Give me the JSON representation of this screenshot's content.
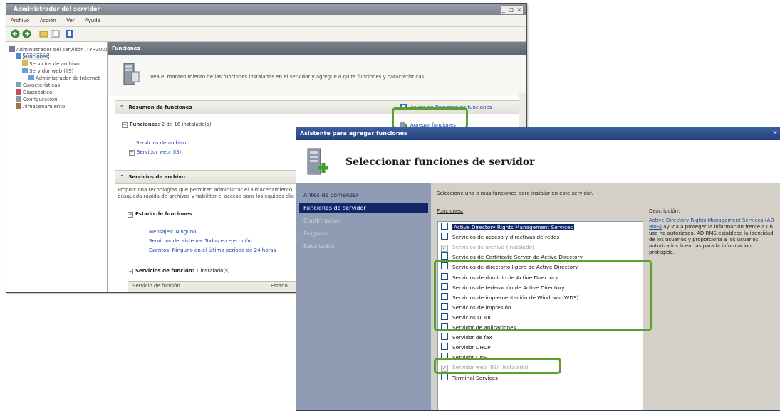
{
  "server_manager": {
    "title": "Administrador del servidor",
    "window_controls": "_ □ ×",
    "menu": [
      "Archivo",
      "Acción",
      "Ver",
      "Ayuda"
    ],
    "tree": [
      {
        "label": "Administrador del servidor (TYR300)",
        "indent": 0,
        "icon": "server-icon"
      },
      {
        "label": "Funciones",
        "indent": 1,
        "icon": "roles-icon",
        "selected": true
      },
      {
        "label": "Servicios de archivo",
        "indent": 2,
        "icon": "file-services-icon"
      },
      {
        "label": "Servidor web (IIS)",
        "indent": 2,
        "icon": "web-server-icon"
      },
      {
        "label": "Administrador de Internet",
        "indent": 3,
        "icon": "iis-manager-icon"
      },
      {
        "label": "Características",
        "indent": 1,
        "icon": "features-icon"
      },
      {
        "label": "Diagnóstico",
        "indent": 1,
        "icon": "diagnostics-icon"
      },
      {
        "label": "Configuración",
        "indent": 1,
        "icon": "configuration-icon"
      },
      {
        "label": "Almacenamiento",
        "indent": 1,
        "icon": "storage-icon"
      }
    ],
    "main_header": "Funciones",
    "intro_text": "Vea el mantenimiento de las funciones instaladas en el servidor y agregue o quite funciones y características.",
    "summary": {
      "title": "Resumen de funciones",
      "help_link": "Ayuda de Resumen de funciones",
      "roles_count_label": "Funciones:",
      "roles_count_value": "2 de 16 instalado(s)",
      "add_roles_link": "Agregar funciones",
      "installed_roles": [
        "Servicios de archivo",
        "Servidor web (IIS)"
      ]
    },
    "file_services": {
      "title": "Servicios de archivo",
      "description_line1": "Proporciona tecnologías que permiten administrar el almacenamiento, fu",
      "description_line2": "búsqueda rápida de archivos y habilitar el acceso para los equipos clie",
      "status_title": "Estado de funciones",
      "status_links": [
        "Mensajes: Ninguno",
        "Servicios del sistema: Todos en ejecución",
        "Eventos: Ninguno en el último período de 24 horas"
      ],
      "role_services_title": "Servicios de función:",
      "role_services_count": "1 instalado(s)",
      "table_headers": [
        "Servicio de función",
        "Estado"
      ]
    }
  },
  "wizard": {
    "title": "Asistente para agregar funciones",
    "close_label": "×",
    "heading": "Seleccionar funciones de servidor",
    "nav": [
      {
        "label": "Antes de comenzar",
        "state": "normal"
      },
      {
        "label": "Funciones de servidor",
        "state": "active"
      },
      {
        "label": "Confirmación",
        "state": "disabled"
      },
      {
        "label": "Progreso",
        "state": "disabled"
      },
      {
        "label": "Resultados",
        "state": "disabled"
      }
    ],
    "instruction": "Seleccione una o más funciones para instalar en este servidor.",
    "roles_label": "Funciones:",
    "roles": [
      {
        "label": "Active Directory Rights Management Services",
        "checked": false,
        "disabled": false,
        "highlighted": true
      },
      {
        "label": "Servicios de acceso y directivas de redes",
        "checked": false,
        "disabled": false,
        "highlighted": false
      },
      {
        "label": "Servicios de archivo (Instalado)",
        "checked": true,
        "disabled": true,
        "highlighted": false
      },
      {
        "label": "Servicios de Certificate Server de Active Directory",
        "checked": false,
        "disabled": false,
        "highlighted": false
      },
      {
        "label": "Servicios de directorio ligero de Active Directory",
        "checked": false,
        "disabled": false,
        "highlighted": false
      },
      {
        "label": "Servicios de dominio de Active Directory",
        "checked": false,
        "disabled": false,
        "highlighted": false
      },
      {
        "label": "Servicios de federación de Active Directory",
        "checked": false,
        "disabled": false,
        "highlighted": false
      },
      {
        "label": "Servicios de implementación de Windows (WDS)",
        "checked": false,
        "disabled": false,
        "highlighted": false
      },
      {
        "label": "Servicios de impresión",
        "checked": false,
        "disabled": false,
        "highlighted": false
      },
      {
        "label": "Servicios UDDI",
        "checked": false,
        "disabled": false,
        "highlighted": false
      },
      {
        "label": "Servidor de aplicaciones",
        "checked": false,
        "disabled": false,
        "highlighted": false
      },
      {
        "label": "Servidor de fax",
        "checked": false,
        "disabled": false,
        "highlighted": false
      },
      {
        "label": "Servidor DHCP",
        "checked": false,
        "disabled": false,
        "highlighted": false
      },
      {
        "label": "Servidor DNS",
        "checked": false,
        "disabled": false,
        "highlighted": false
      },
      {
        "label": "Servidor web (IIS) (Instalado)",
        "checked": true,
        "disabled": true,
        "highlighted": false
      },
      {
        "label": "Terminal Services",
        "checked": false,
        "disabled": false,
        "highlighted": false
      }
    ],
    "description_label": "Descripción:",
    "description_link": "Active Directory Rights Management Services (AD RMS)",
    "description_rest": " ayuda a proteger la información frente a un uso no autorizado. AD RMS establece la identidad de los usuarios y proporciona a los usuarios autorizados licencias para la información protegida."
  },
  "colors": {
    "highlight_box": "#5aa12c",
    "wizard_titlebar": "#2a4a86",
    "nav_active": "#12276a",
    "link": "#2246a8"
  }
}
